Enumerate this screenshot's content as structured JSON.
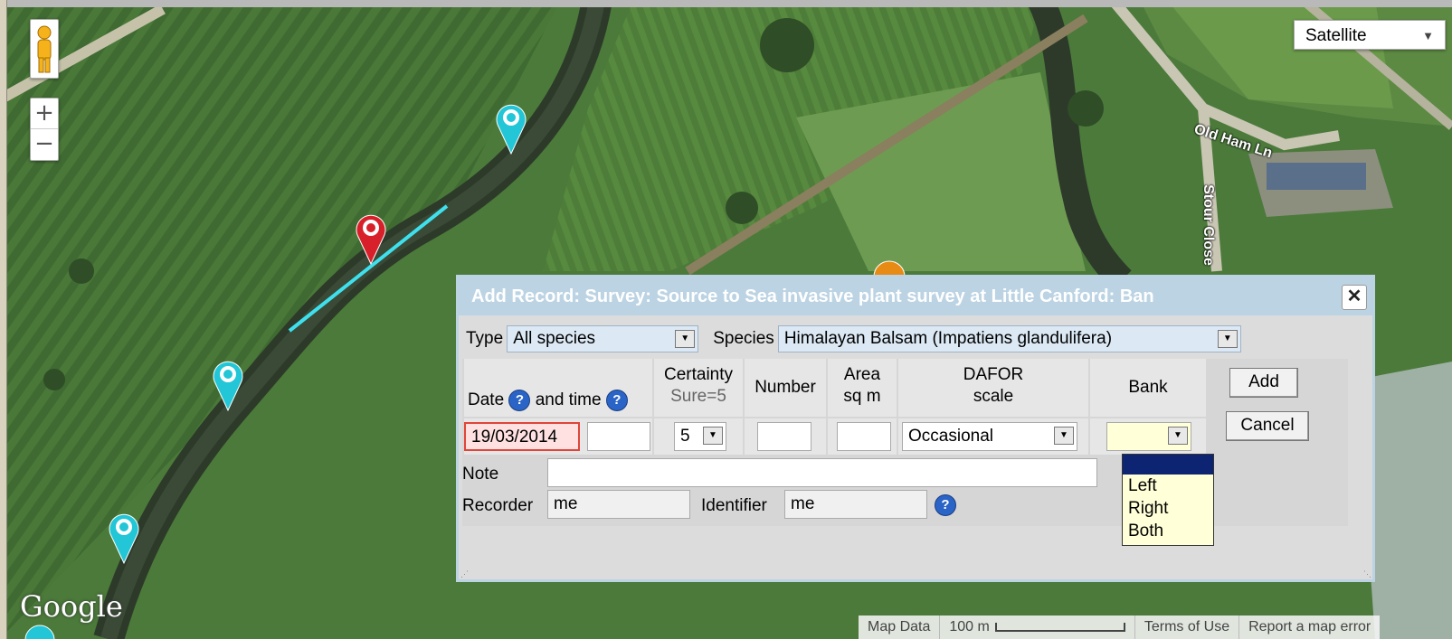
{
  "map": {
    "map_type": "Satellite",
    "zoom_in": "+",
    "zoom_out": "−",
    "logo": "Google",
    "road_labels": [
      "Old Ham Ln",
      "Stour Close"
    ],
    "footer": {
      "map_data": "Map Data",
      "scale_text": "100 m",
      "terms": "Terms of Use",
      "report": "Report a map error"
    }
  },
  "dialog": {
    "title": "Add Record: Survey: Source to Sea invasive plant survey at Little Canford: Ban",
    "close": "✕",
    "type_label": "Type",
    "type_value": "All species",
    "species_label": "Species",
    "species_value": "Himalayan Balsam (Impatiens glandulifera)",
    "headers": {
      "date": "Date",
      "and_time": "and time",
      "certainty": "Certainty",
      "certainty_sub": "Sure=5",
      "number": "Number",
      "area_1": "Area",
      "area_2": "sq m",
      "dafor_1": "DAFOR",
      "dafor_2": "scale",
      "bank": "Bank"
    },
    "values": {
      "date": "19/03/2014",
      "time": "",
      "certainty": "5",
      "number": "",
      "area": "",
      "dafor": "Occasional",
      "bank": ""
    },
    "note_label": "Note",
    "note_value": "",
    "recorder_label": "Recorder",
    "recorder_value": "me",
    "identifier_label": "Identifier",
    "identifier_value": "me",
    "help_glyph": "?",
    "add_button": "Add",
    "cancel_button": "Cancel",
    "bank_options": [
      "",
      "Left",
      "Right",
      "Both"
    ]
  },
  "colors": {
    "titlebar": "#bcd3e3",
    "date_invalid_border": "#e0453a",
    "date_invalid_bg": "#ffe1e1",
    "marker_red": "#d8202a",
    "marker_cyan": "#22c6d6",
    "marker_orange": "#e88b15"
  }
}
